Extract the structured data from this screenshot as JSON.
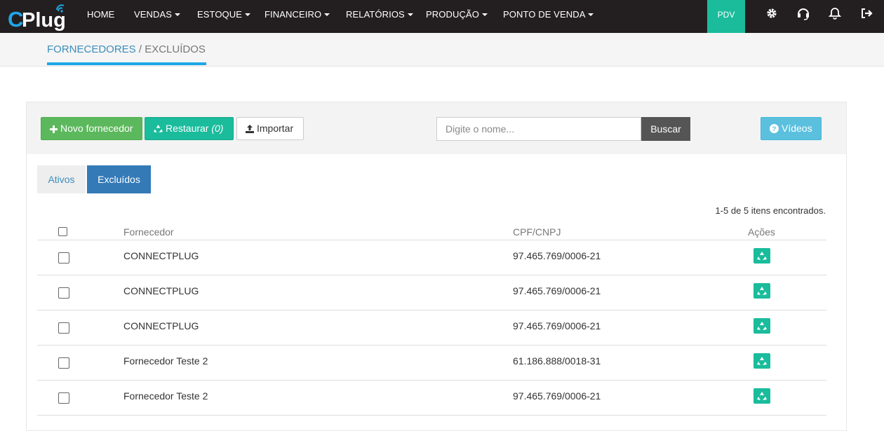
{
  "brand": {
    "logo_text": "CPlug"
  },
  "nav": {
    "items": [
      {
        "label": "HOME",
        "dropdown": false
      },
      {
        "label": "VENDAS",
        "dropdown": true
      },
      {
        "label": "ESTOQUE",
        "dropdown": true
      },
      {
        "label": "FINANCEIRO",
        "dropdown": true
      },
      {
        "label": "RELATÓRIOS",
        "dropdown": true
      },
      {
        "label": "PRODUÇÃO",
        "dropdown": true
      },
      {
        "label": "PONTO DE VENDA",
        "dropdown": true
      }
    ],
    "pdv_label": "PDV",
    "icons": [
      "gear-icon",
      "headset-icon",
      "bell-icon",
      "logout-icon"
    ]
  },
  "breadcrumb": {
    "parent": "FORNECEDORES",
    "separator": " / ",
    "current": "EXCLUÍDOS"
  },
  "toolbar": {
    "new_label": "Novo fornecedor",
    "restore_label": "Restaurar",
    "restore_count": "(0)",
    "import_label": "Importar",
    "search_placeholder": "Digite o nome...",
    "search_button": "Buscar",
    "videos_label": "Vídeos"
  },
  "tabs": [
    {
      "label": "Ativos",
      "active": false
    },
    {
      "label": "Excluídos",
      "active": true
    }
  ],
  "results_count": "1-5 de 5 itens encontrados.",
  "table": {
    "columns": [
      "Fornecedor",
      "CPF/CNPJ",
      "Ações"
    ],
    "rows": [
      {
        "name": "CONNECTPLUG",
        "doc": "97.465.769/0006-21"
      },
      {
        "name": "CONNECTPLUG",
        "doc": "97.465.769/0006-21"
      },
      {
        "name": "CONNECTPLUG",
        "doc": "97.465.769/0006-21"
      },
      {
        "name": "Fornecedor Teste 2",
        "doc": "61.186.888/0018-31"
      },
      {
        "name": "Fornecedor Teste 2",
        "doc": "97.465.769/0006-21"
      }
    ]
  },
  "colors": {
    "navbar": "#231f20",
    "accent_teal": "#1abc9c",
    "green": "#5cb85c",
    "primary_blue": "#337ab7",
    "info": "#5bc0de"
  }
}
